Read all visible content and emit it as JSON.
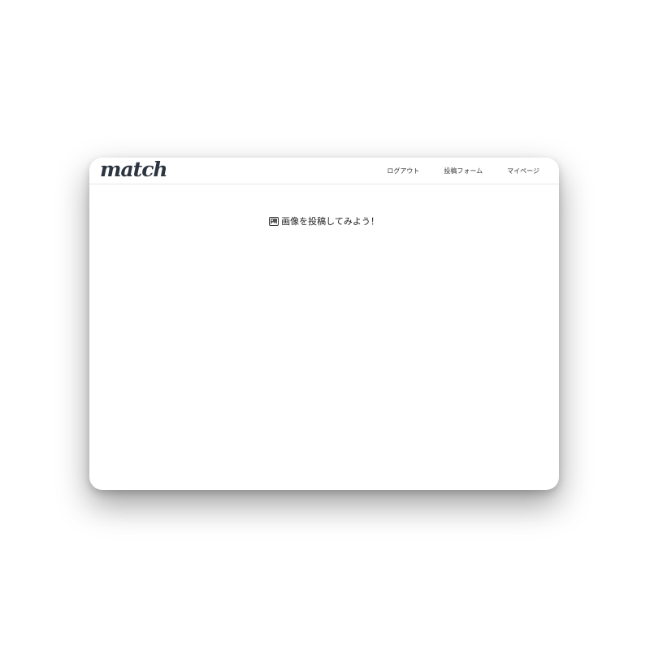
{
  "header": {
    "logo": "match",
    "nav": [
      {
        "label": "ログアウト"
      },
      {
        "label": "投稿フォーム"
      },
      {
        "label": "マイページ"
      }
    ]
  },
  "main": {
    "prompt_icon": "picture-icon",
    "prompt_text": "画像を投稿してみよう！"
  }
}
